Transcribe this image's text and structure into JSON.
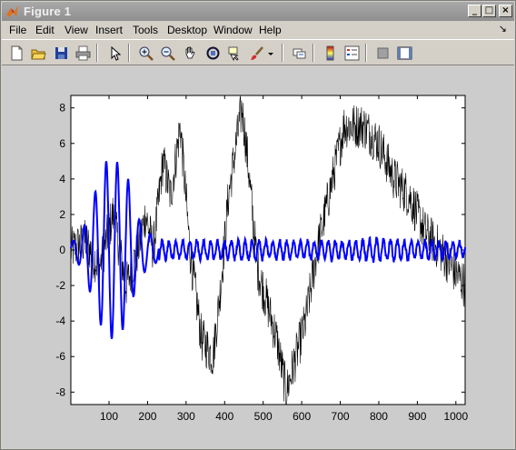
{
  "window": {
    "title": "Figure 1"
  },
  "menu": [
    "File",
    "Edit",
    "View",
    "Insert",
    "Tools",
    "Desktop",
    "Window",
    "Help"
  ],
  "menu_arrow": "↘",
  "toolbar": {
    "icons": [
      "new-figure-icon",
      "open-file-icon",
      "save-icon",
      "print-icon",
      "edit-plot-arrow-icon",
      "zoom-in-icon",
      "zoom-out-icon",
      "pan-hand-icon",
      "rotate-3d-icon",
      "data-cursor-icon",
      "brush-icon",
      "brush-dropdown-icon",
      "link-plot-icon",
      "colorbar-icon",
      "legend-icon",
      "hide-plot-tools-icon",
      "show-plot-tools-icon"
    ]
  },
  "colors": {
    "background": "#cccccc",
    "axes_bg": "#ffffff",
    "series_black": "#000000",
    "series_blue": "#0000ff"
  },
  "chart_data": {
    "type": "line",
    "xlim": [
      1,
      1024
    ],
    "ylim": [
      -8.7,
      8.7
    ],
    "x_ticks": [
      100,
      200,
      300,
      400,
      500,
      600,
      700,
      800,
      900,
      1000
    ],
    "y_ticks": [
      -8,
      -6,
      -4,
      -2,
      0,
      2,
      4,
      6,
      8
    ],
    "grid": false,
    "series": [
      {
        "color": "#000000",
        "linewidth": 0.6,
        "noise_amplitude": 1.3,
        "points": [
          [
            1,
            0
          ],
          [
            40,
            0.5
          ],
          [
            75,
            -1
          ],
          [
            110,
            2
          ],
          [
            145,
            -2
          ],
          [
            175,
            0
          ],
          [
            195,
            2
          ],
          [
            215,
            0
          ],
          [
            240,
            5
          ],
          [
            260,
            3
          ],
          [
            285,
            7
          ],
          [
            310,
            0
          ],
          [
            340,
            -5
          ],
          [
            370,
            -6
          ],
          [
            390,
            -2
          ],
          [
            410,
            3
          ],
          [
            430,
            6
          ],
          [
            445,
            8
          ],
          [
            460,
            5
          ],
          [
            485,
            -1
          ],
          [
            510,
            -3
          ],
          [
            535,
            -5
          ],
          [
            560,
            -8
          ],
          [
            585,
            -6
          ],
          [
            610,
            -4
          ],
          [
            640,
            0
          ],
          [
            680,
            4
          ],
          [
            710,
            7
          ],
          [
            760,
            7
          ],
          [
            800,
            6
          ],
          [
            840,
            4
          ],
          [
            880,
            3
          ],
          [
            920,
            1
          ],
          [
            960,
            0
          ],
          [
            990,
            -1
          ],
          [
            1024,
            -2
          ]
        ]
      },
      {
        "color": "#0000ff",
        "linewidth": 2,
        "envelope": [
          [
            1,
            0.4
          ],
          [
            30,
            1
          ],
          [
            60,
            3
          ],
          [
            90,
            5
          ],
          [
            120,
            5
          ],
          [
            150,
            4
          ],
          [
            170,
            2
          ],
          [
            200,
            1
          ],
          [
            240,
            0.5
          ],
          [
            300,
            0.5
          ],
          [
            400,
            0.5
          ],
          [
            500,
            0.5
          ],
          [
            600,
            0.5
          ],
          [
            700,
            0.5
          ],
          [
            800,
            0.6
          ],
          [
            900,
            0.5
          ],
          [
            1024,
            0.4
          ]
        ]
      }
    ]
  }
}
